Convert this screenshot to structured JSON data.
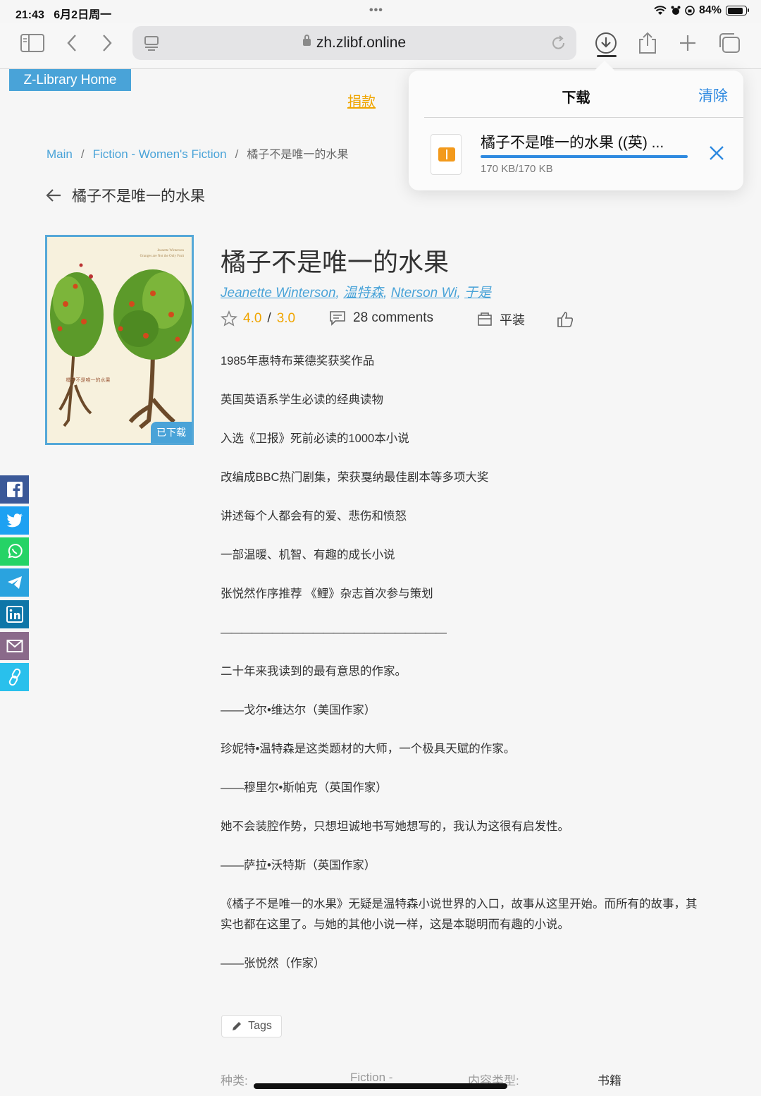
{
  "status_bar": {
    "time": "21:43",
    "date": "6月2日周一",
    "battery": "84%",
    "battery_level": 0.84
  },
  "browser": {
    "url": "zh.zlibf.online"
  },
  "site": {
    "home_label": "Z-Library Home",
    "donate_label": "捐款"
  },
  "breadcrumb": {
    "items": [
      "Main",
      "Fiction - Women's Fiction"
    ],
    "current": "橘子不是唯一的水果"
  },
  "back_title": "橘子不是唯一的水果",
  "cover": {
    "badge": "已下载",
    "title_text": "橘子不是唯一的水果",
    "subtitle_text": "Oranges are Not the Only Fruit",
    "author_text": "Jeanette Winterson"
  },
  "book": {
    "title": "橘子不是唯一的水果",
    "authors": [
      "Jeanette Winterson",
      "温特森",
      "Nterson Wi",
      "于是"
    ],
    "rating_a": "4.0",
    "rating_sep": "/",
    "rating_b": "3.0",
    "comments": "28 comments",
    "binding": "平装"
  },
  "description": [
    "1985年惠特布莱德奖获奖作品",
    "英国英语系学生必读的经典读物",
    "入选《卫报》死前必读的1000本小说",
    "改编成BBC热门剧集，荣获戛纳最佳剧本等多项大奖",
    "讲述每个人都会有的爱、悲伤和愤怒",
    "一部温暖、机智、有趣的成长小说",
    "张悦然作序推荐 《鲤》杂志首次参与策划",
    "——————————————————————",
    "二十年来我读到的最有意思的作家。",
    "——戈尔•维达尔（美国作家）",
    "珍妮特•温特森是这类题材的大师，一个极具天赋的作家。",
    "——穆里尔•斯帕克（英国作家）",
    "她不会装腔作势，只想坦诚地书写她想写的，我认为这很有启发性。",
    "——萨拉•沃特斯（英国作家）",
    "《橘子不是唯一的水果》无疑是温特森小说世界的入口，故事从这里开始。而所有的故事，其实也都在这里了。与她的其他小说一样，这是本聪明而有趣的小说。",
    "——张悦然（作家）"
  ],
  "tags_label": "Tags",
  "properties": {
    "category_label": "种类:",
    "category_value": "Fiction -",
    "content_type_label": "内容类型:",
    "content_type_value": "书籍"
  },
  "download_popover": {
    "title": "下载",
    "clear_label": "清除",
    "file_name": "橘子不是唯一的水果 ((英) ...",
    "file_size": "170 KB/170 KB",
    "progress": 1.0
  },
  "colors": {
    "accent": "#49a3d8",
    "rating": "#f0a500",
    "ios_blue": "#2f8ae0"
  }
}
